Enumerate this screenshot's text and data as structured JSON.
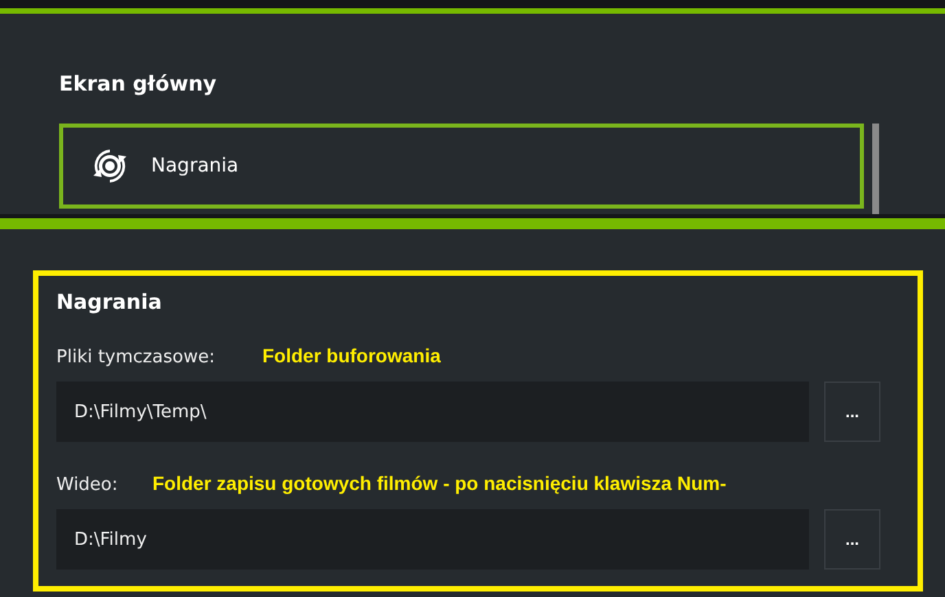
{
  "home_panel": {
    "title": "Ekran główny",
    "items": [
      {
        "label": "Nagrania",
        "selected": true
      }
    ]
  },
  "recordings_panel": {
    "title": "Nagrania",
    "fields": [
      {
        "label": "Pliki tymczasowe:",
        "annotation": "Folder buforowania",
        "value": "D:\\Filmy\\Temp\\",
        "button": "..."
      },
      {
        "label": "Wideo:",
        "annotation": "Folder zapisu gotowych filmów - po nacisnięciu klawisza Num-",
        "value": "D:\\Filmy",
        "button": "..."
      }
    ]
  }
}
